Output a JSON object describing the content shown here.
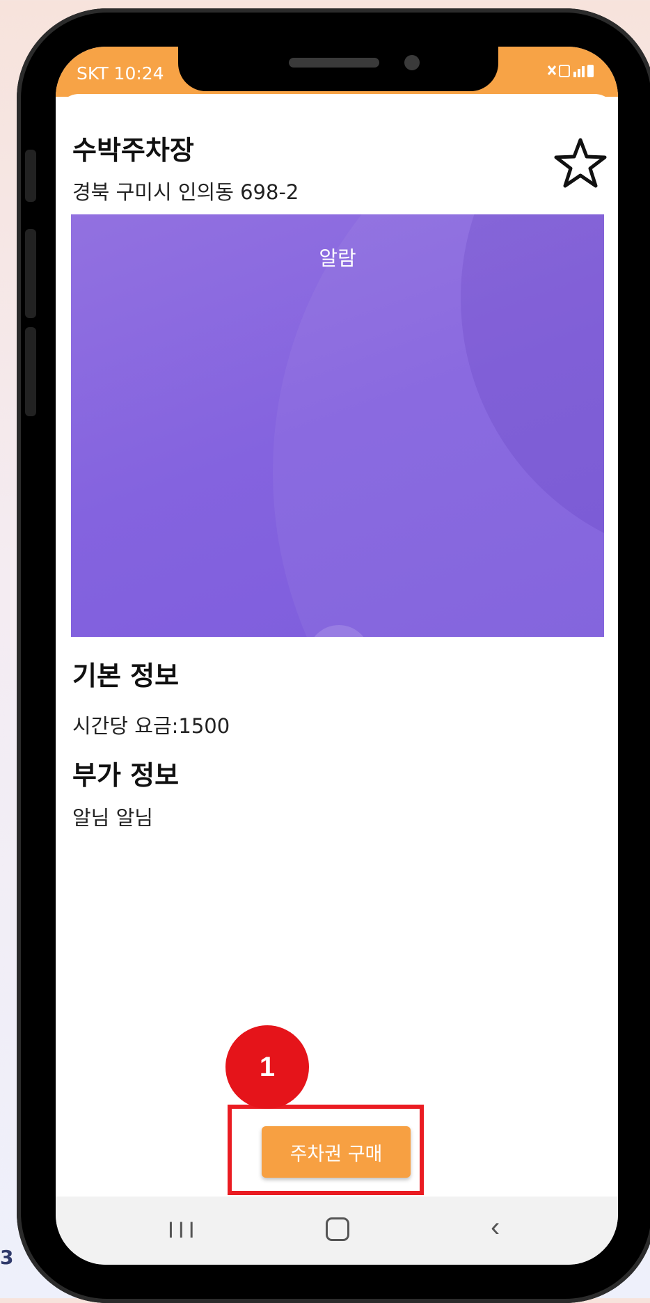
{
  "status_bar": {
    "carrier_time": "SKT 10:24",
    "icons": "⚡ ▮"
  },
  "parking": {
    "name": "수박주차장",
    "address": "경북 구미시 인의동 698-2"
  },
  "banner": {
    "label": "알람"
  },
  "basic_info": {
    "heading": "기본 정보",
    "rate": "시간당 요금:1500"
  },
  "extra_info": {
    "heading": "부가 정보",
    "text": "알님 알님"
  },
  "tutorial": {
    "step_number": "1"
  },
  "actions": {
    "buy_label": "주차권 구매"
  },
  "nav": {
    "recent_glyph": "III",
    "back_glyph": "‹"
  },
  "edge_text": "3",
  "colors": {
    "accent": "#f7a346",
    "banner": "#8463df",
    "highlight": "#ea1c22"
  },
  "icons": [
    "star-outline-icon",
    "home-icon",
    "recent-apps-icon",
    "back-icon"
  ]
}
